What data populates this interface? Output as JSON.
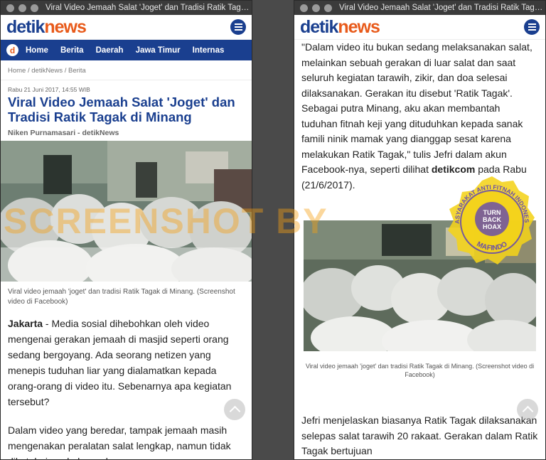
{
  "window_title": "Viral Video Jemaah Salat 'Joget' dan Tradisi Ratik Tagak di Minang",
  "window_title_right": "Viral Video Jemaah Salat 'Joget' dan Tradisi Ratik Tagak...",
  "logo": {
    "part1": "detik",
    "part2": "news"
  },
  "nav": {
    "logo_letter": "d",
    "items": [
      "Home",
      "Berita",
      "Daerah",
      "Jawa Timur",
      "Internas"
    ]
  },
  "breadcrumb": "Home / detikNews / Berita",
  "article": {
    "date": "Rabu 21 Juni 2017, 14:55 WIB",
    "title": "Viral Video Jemaah Salat 'Joget' dan Tradisi Ratik Tagak di Minang",
    "author": "Niken Purnamasari - detikNews",
    "caption": "Viral video jemaah 'joget' dan tradisi Ratik Tagak di Minang. (Screenshot video di Facebook)",
    "lead_city": "Jakarta",
    "lead_text": " - Media sosial dihebohkan oleh video mengenai gerakan jemaah di masjid seperti orang sedang bergoyang. Ada seorang netizen yang menepis tuduhan liar yang dialamatkan kepada orang-orang di video itu. Sebenarnya apa kegiatan tersebut?",
    "para2": "Dalam video yang beredar, tampak jemaah masih mengenakan peralatan salat lengkap, namun tidak diketahui apakah gerakan goyangan"
  },
  "right": {
    "quote": "\"Dalam video itu bukan sedang melaksanakan salat, melainkan sebuah gerakan di luar salat dan saat seluruh kegiatan tarawih, zikir, dan doa selesai dilaksanakan. Gerakan itu disebut 'Ratik Tagak'. Sebagai putra Minang, aku akan membantah tuduhan fitnah keji yang dituduhkan kepada sanak famili ninik mamak yang dianggap sesat karena melakukan Ratik Tagak,\" tulis Jefri dalam akun Facebook-nya, seperti dilihat ",
    "quote_bold": "detikcom",
    "quote_end": " pada Rabu (21/6/2017).",
    "caption": "Viral video jemaah 'joget' dan tradisi Ratik Tagak di Minang. (Screenshot video di Facebook)",
    "para": "Jefri menjelaskan biasanya Ratik Tagak dilaksanakan selepas salat tarawih 20 rakaat. Gerakan dalam Ratik Tagak bertujuan"
  },
  "watermark": "SCREENSHOT BY",
  "seal": {
    "top_text": "MASYARAKAT ANTI FITNAH INDONESIA",
    "center_lines": [
      "TURN",
      "BACK",
      "HOAX"
    ],
    "bottom_text": "MAFINDO"
  },
  "icons": {
    "menu": "hamburger-menu-icon",
    "scroll": "chevron-up-icon"
  },
  "colors": {
    "brand_blue": "#1a3f8f",
    "brand_orange": "#e85a1a",
    "watermark": "#f5a014",
    "seal_yellow": "#f4d31a",
    "seal_purple": "#6a4fa8"
  }
}
